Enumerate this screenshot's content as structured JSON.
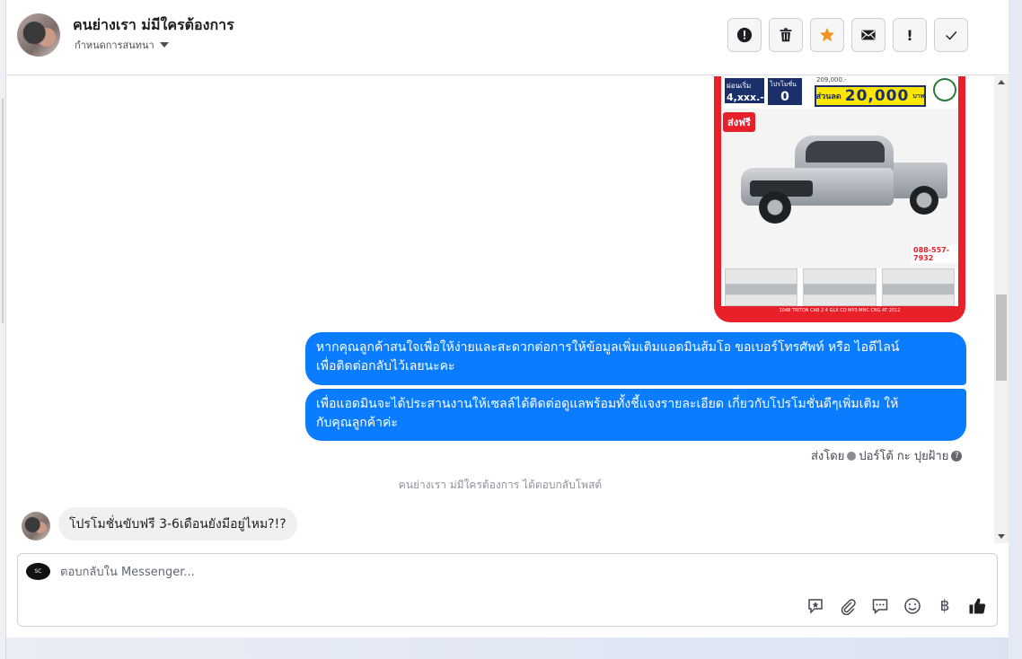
{
  "header": {
    "name": "คนย่างเรา ม่มีใครต้องการ",
    "subtitle": "กำหนดการสนทนา",
    "actions": [
      {
        "name": "report-icon",
        "glyph": "!"
      },
      {
        "name": "trash-icon"
      },
      {
        "name": "star-icon"
      },
      {
        "name": "mail-icon"
      },
      {
        "name": "exclamation-icon",
        "glyph": "!"
      },
      {
        "name": "check-icon"
      }
    ]
  },
  "image_card": {
    "price_label": "ผ่อนเริ่ม",
    "price_value": "4,xxx.-",
    "down_label": "โปรโมชั่น",
    "down_value": "0",
    "original_price": "209,000.-",
    "discount_label": "ส่วนลด",
    "discount_value": "20,000",
    "discount_unit": "บาท",
    "free_shipping": "ส่งฟรี",
    "phone": "088-557-7932",
    "footer": "1048 TRITON CAB 2.4 GLX CD MP3 MNC CNG AT 2012"
  },
  "messages": {
    "out_1": "หากคุณลูกค้าสนใจเพื่อให้ง่ายและสะดวกต่อการให้ข้อมูลเพิ่มเติมแอดมินส้มโอ ขอเบอร์โทรศัพท์ หรือ ไอดีไลน์",
    "out_1b": "เพื่อติดต่อกลับไว้เลยนะคะ",
    "out_2": "เพื่อแอดมินจะได้ประสานงานให้เซลล์ได้ติดต่อดูแลพร้อมทั้งชี้แจงรายละเอียด เกี่ยวกับโปรโมชั่นดีๆเพิ่มเติม ให้",
    "out_2b": "กับคุณลูกค้าค่ะ",
    "sent_by_label": "ส่งโดย",
    "sent_by_name": "ปอร์โต้ กะ ปุยฝ้าย",
    "reply_note": "คนย่างเรา ม่มีใครต้องการ ได้ตอบกลับโพสต์",
    "in_1": "โปรโมชั่นขับฟรี 3-6เดือนยังมีอยู่ไหม?!?"
  },
  "composer": {
    "placeholder": "ตอบกลับใน Messenger...",
    "page_avatar_text": "SC",
    "tools": [
      "saved-reply-icon",
      "attachment-icon",
      "quick-reply-icon",
      "emoji-icon",
      "baht-icon",
      "like-icon"
    ],
    "baht_glyph": "฿"
  }
}
